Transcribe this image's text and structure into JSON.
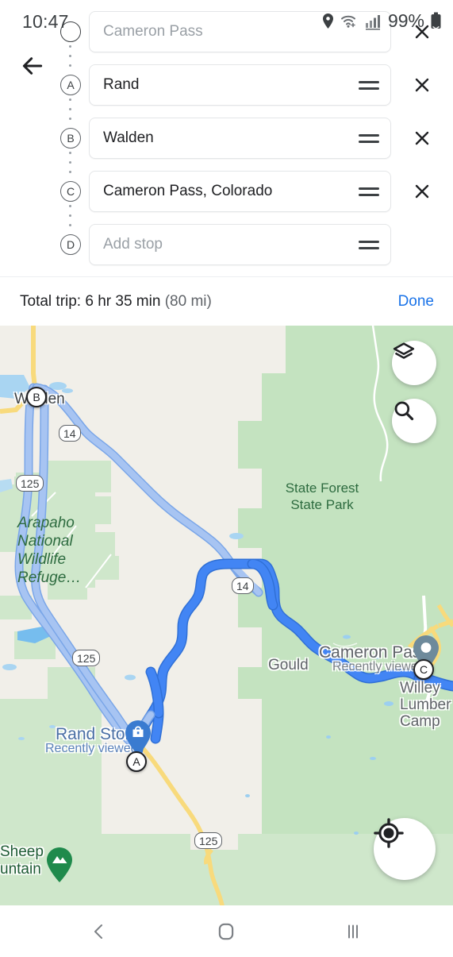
{
  "status_bar": {
    "time": "10:47",
    "battery_percent": "99%",
    "icons": [
      "location-pin-icon",
      "wifi-icon",
      "signal-bars-icon",
      "battery-icon"
    ]
  },
  "route_editor": {
    "back_label": "←",
    "stops": [
      {
        "marker": "",
        "marker_type": "origin-circle",
        "value": "",
        "placeholder": "Cameron Pass",
        "has_clear": true,
        "has_drag": false
      },
      {
        "marker": "A",
        "marker_type": "letter",
        "value": "Rand",
        "placeholder": "",
        "has_clear": true,
        "has_drag": true
      },
      {
        "marker": "B",
        "marker_type": "letter",
        "value": "Walden",
        "placeholder": "",
        "has_clear": true,
        "has_drag": true
      },
      {
        "marker": "C",
        "marker_type": "letter",
        "value": "Cameron Pass, Colorado",
        "placeholder": "",
        "has_clear": true,
        "has_drag": true
      },
      {
        "marker": "D",
        "marker_type": "letter",
        "value": "",
        "placeholder": "Add stop",
        "has_clear": false,
        "has_drag": true
      }
    ]
  },
  "summary": {
    "total_label": "Total trip: 6 hr 35 min",
    "distance": "(80 mi)",
    "done_label": "Done"
  },
  "map": {
    "labels": {
      "walden": "Walden",
      "state_forest": "State Forest\nState Park",
      "arapaho": "Arapaho\nNational\nWildlife\nRefuge…",
      "gould": "Gould",
      "cameron_pass_title": "Cameron Pass",
      "cameron_pass_sub": "Recently viewed",
      "willey": "Willey\nLumber Camp",
      "rand_store_title": "Rand Store",
      "rand_store_sub": "Recently viewed",
      "sheep_mountain": "Sheep\nuntain"
    },
    "shields": {
      "hwy14_north": "14",
      "hwy14_mid": "14",
      "hwy125_north": "125",
      "hwy125_mid": "125",
      "hwy125_south": "125"
    },
    "waypoints": {
      "a": "A",
      "b": "B",
      "c": "C"
    },
    "controls": {
      "layers": "layers-icon",
      "search": "search-icon",
      "my_location": "my-location-icon"
    },
    "colors": {
      "route_active": "#4285f4",
      "route_inactive": "#a7c4f2",
      "land": "#f1efe9",
      "park": "#cbe7c8",
      "forest": "#bfe0bb",
      "water": "#a7d4f0",
      "road_yellow": "#f8da7c"
    }
  },
  "nav_bar": {
    "back": "back-icon",
    "home": "home-icon",
    "recents": "recents-icon"
  }
}
